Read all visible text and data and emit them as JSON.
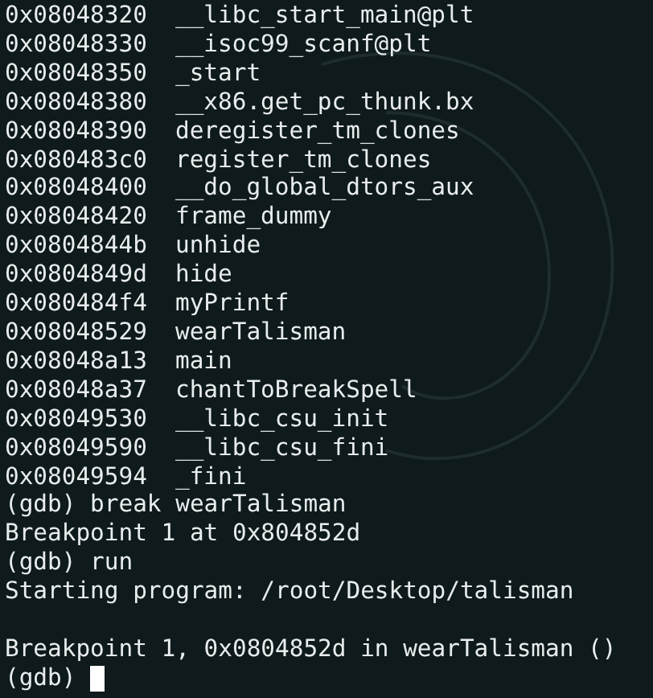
{
  "symbols": [
    {
      "address": "0x08048320",
      "name": "__libc_start_main@plt"
    },
    {
      "address": "0x08048330",
      "name": "__isoc99_scanf@plt"
    },
    {
      "address": "0x08048350",
      "name": "_start"
    },
    {
      "address": "0x08048380",
      "name": "__x86.get_pc_thunk.bx"
    },
    {
      "address": "0x08048390",
      "name": "deregister_tm_clones"
    },
    {
      "address": "0x080483c0",
      "name": "register_tm_clones"
    },
    {
      "address": "0x08048400",
      "name": "__do_global_dtors_aux"
    },
    {
      "address": "0x08048420",
      "name": "frame_dummy"
    },
    {
      "address": "0x0804844b",
      "name": "unhide"
    },
    {
      "address": "0x0804849d",
      "name": "hide"
    },
    {
      "address": "0x080484f4",
      "name": "myPrintf"
    },
    {
      "address": "0x08048529",
      "name": "wearTalisman"
    },
    {
      "address": "0x08048a13",
      "name": "main"
    },
    {
      "address": "0x08048a37",
      "name": "chantToBreakSpell"
    },
    {
      "address": "0x08049530",
      "name": "__libc_csu_init"
    },
    {
      "address": "0x08049590",
      "name": "__libc_csu_fini"
    },
    {
      "address": "0x08049594",
      "name": "_fini"
    }
  ],
  "session": [
    "(gdb) break wearTalisman",
    "Breakpoint 1 at 0x804852d",
    "(gdb) run",
    "Starting program: /root/Desktop/talisman"
  ],
  "stop_message": "Breakpoint 1, 0x0804852d in wearTalisman ()",
  "prompt": "(gdb)"
}
